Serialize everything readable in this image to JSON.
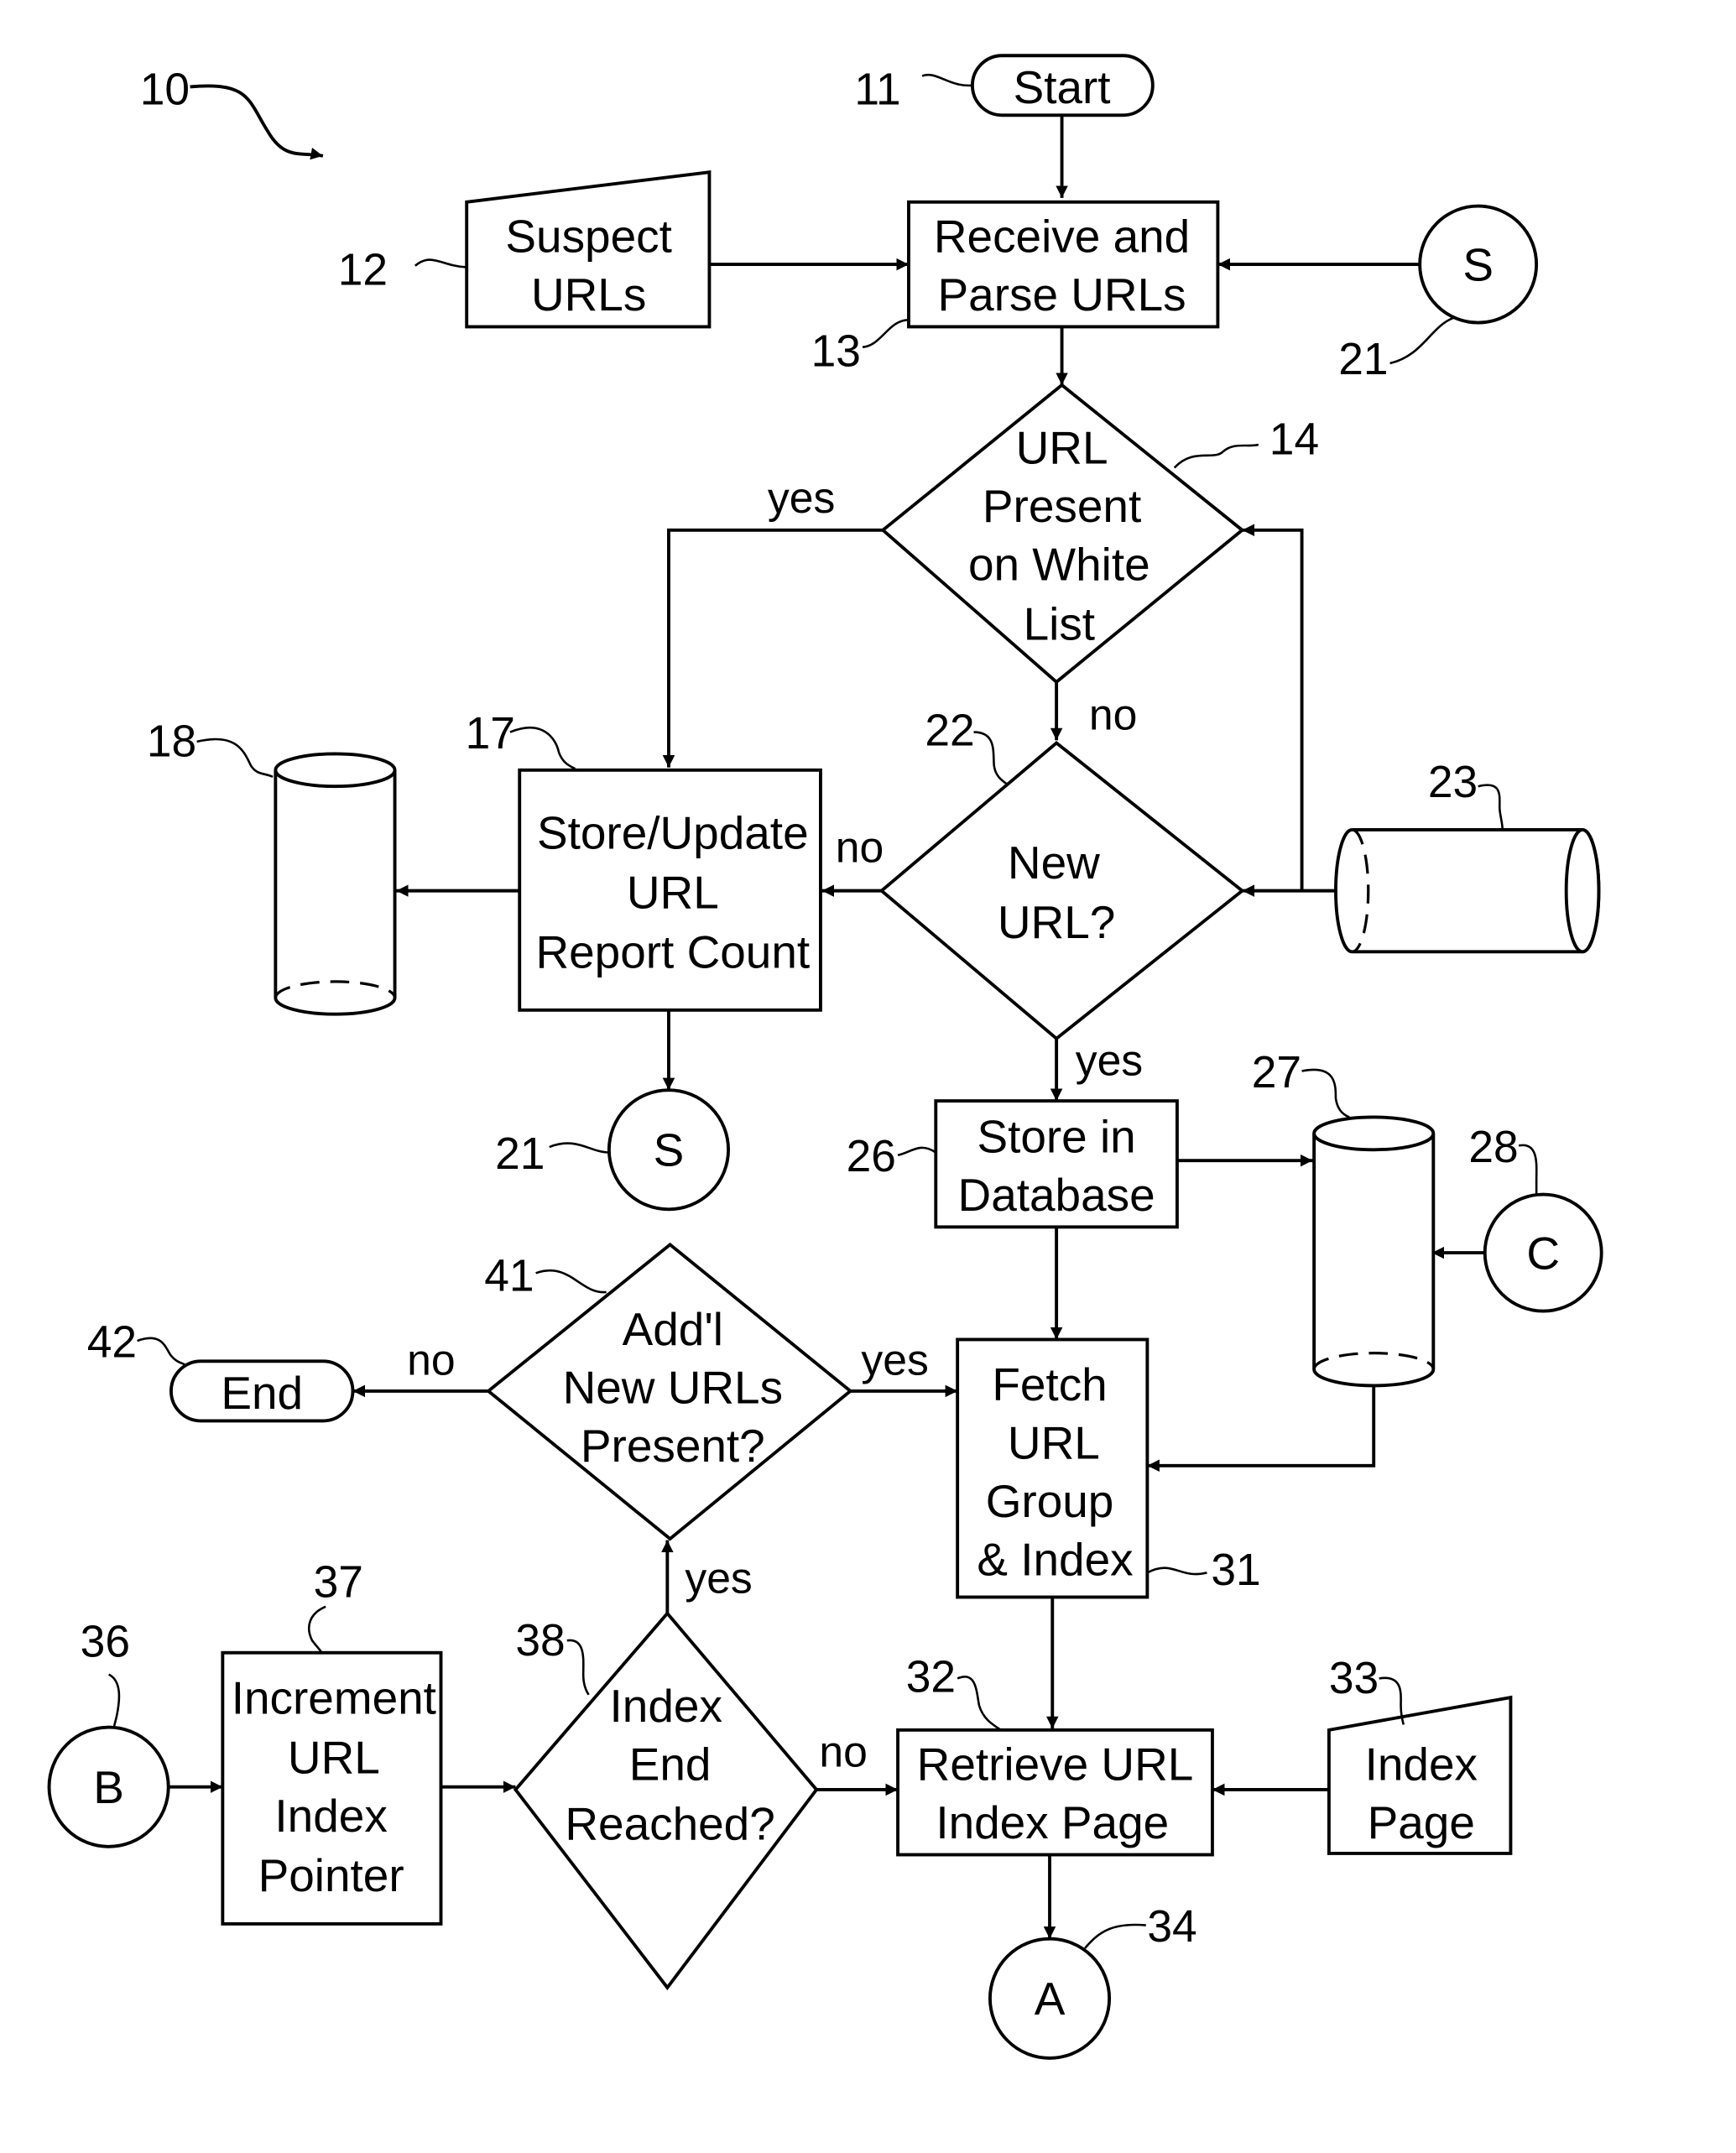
{
  "figure": {
    "ref": "10",
    "nodes": {
      "start": {
        "ref": "11",
        "label": [
          "Start"
        ]
      },
      "suspect_urls": {
        "ref": "12",
        "label": [
          "Suspect",
          "URLs"
        ]
      },
      "receive_parse": {
        "ref": "13",
        "label": [
          "Receive and",
          "Parse URLs"
        ]
      },
      "white_list": {
        "ref": "14",
        "label": [
          "URL",
          "Present",
          "on White",
          "List"
        ]
      },
      "store_update": {
        "ref": "17",
        "label": [
          "Store/Update",
          "URL",
          "Report Count"
        ]
      },
      "db_18": {
        "ref": "18"
      },
      "connector_s_top": {
        "ref": "21",
        "label": [
          "S"
        ]
      },
      "connector_s_bottom": {
        "ref": "21",
        "label": [
          "S"
        ]
      },
      "new_url": {
        "ref": "22",
        "label": [
          "New",
          "URL?"
        ]
      },
      "db_23": {
        "ref": "23"
      },
      "store_db": {
        "ref": "26",
        "label": [
          "Store in",
          "Database"
        ]
      },
      "db_27": {
        "ref": "27"
      },
      "connector_c": {
        "ref": "28",
        "label": [
          "C"
        ]
      },
      "fetch_group": {
        "ref": "31",
        "label": [
          "Fetch",
          "URL",
          "Group",
          "& Index"
        ]
      },
      "retrieve_index": {
        "ref": "32",
        "label": [
          "Retrieve URL",
          "Index Page"
        ]
      },
      "index_page": {
        "ref": "33",
        "label": [
          "Index",
          "Page"
        ]
      },
      "connector_a": {
        "ref": "34",
        "label": [
          "A"
        ]
      },
      "connector_b": {
        "ref": "36",
        "label": [
          "B"
        ]
      },
      "increment": {
        "ref": "37",
        "label": [
          "Increment",
          "URL",
          "Index",
          "Pointer"
        ]
      },
      "index_end": {
        "ref": "38",
        "label": [
          "Index",
          "End",
          "Reached?"
        ]
      },
      "addl_urls": {
        "ref": "41",
        "label": [
          "Add'l",
          "New URLs",
          "Present?"
        ]
      },
      "end": {
        "ref": "42",
        "label": [
          "End"
        ]
      }
    },
    "edge_labels": {
      "white_list_yes": "yes",
      "white_list_no": "no",
      "new_url_no": "no",
      "new_url_yes": "yes",
      "addl_no": "no",
      "addl_yes": "yes",
      "index_end_yes": "yes",
      "index_end_no": "no"
    }
  }
}
